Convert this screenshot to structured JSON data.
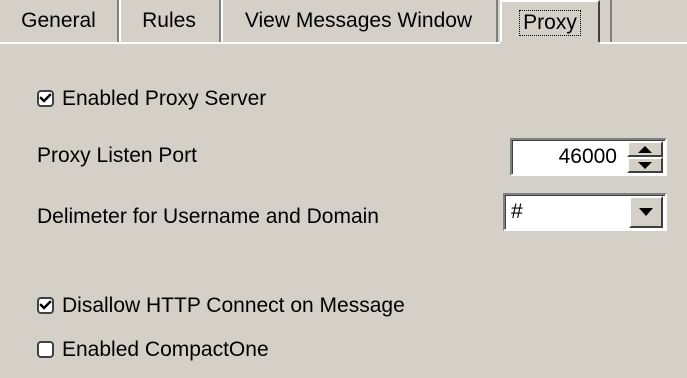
{
  "tabs": [
    {
      "label": "General"
    },
    {
      "label": "Rules"
    },
    {
      "label": "View Messages Window"
    },
    {
      "label": "Proxy"
    }
  ],
  "active_tab": "Proxy",
  "proxy": {
    "enabled_proxy_label": "Enabled Proxy Server",
    "enabled_proxy_checked": true,
    "listen_port_label": "Proxy Listen Port",
    "listen_port_value": "46000",
    "delimiter_label": "Delimeter for Username and Domain",
    "delimiter_value": "#",
    "disallow_label": "Disallow HTTP Connect on Message",
    "disallow_checked": true,
    "compactone_label": "Enabled CompactOne",
    "compactone_checked": false
  }
}
